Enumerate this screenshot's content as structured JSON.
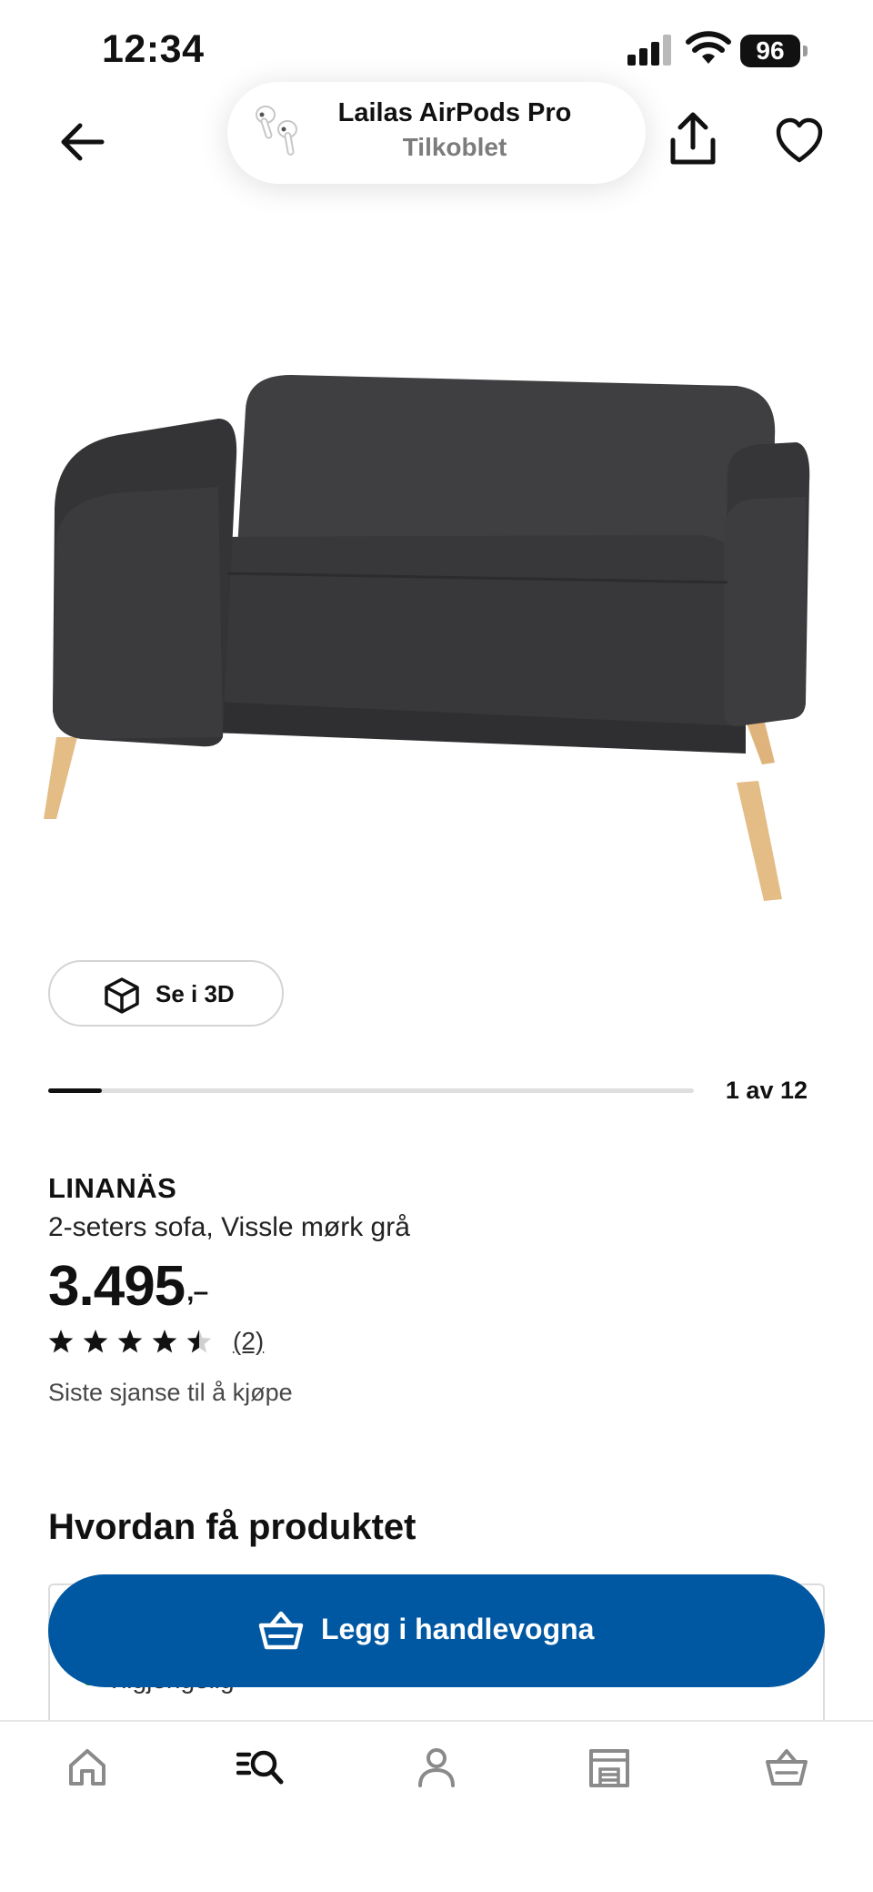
{
  "status_bar": {
    "time": "12:34",
    "battery": "96"
  },
  "header": {
    "airpods_name": "Lailas AirPods Pro",
    "airpods_status": "Tilkoblet"
  },
  "gallery": {
    "view_3d_label": "Se i 3D",
    "counter": "1 av 12",
    "progress_fraction": 0.0833
  },
  "product": {
    "name": "LINANÄS",
    "description": "2-seters sofa, Vissle mørk grå",
    "price": "3.495",
    "price_suffix": ",–",
    "rating": 4.5,
    "rating_count": "(2)",
    "status_note": "Siste sjanse til å kjøpe"
  },
  "delivery": {
    "heading": "Hvordan få produktet",
    "card_text": "Tilgjengelig"
  },
  "cta": {
    "label": "Legg i handlevogna"
  },
  "bottom_nav": {
    "items": [
      "home-icon",
      "search-icon",
      "profile-icon",
      "store-icon",
      "cart-icon"
    ]
  },
  "colors": {
    "accent": "#0058a3",
    "text": "#111111",
    "available_green": "#0a8a00",
    "sofa_fabric": "#3a3a3c",
    "sofa_legs": "#e4bc86"
  }
}
